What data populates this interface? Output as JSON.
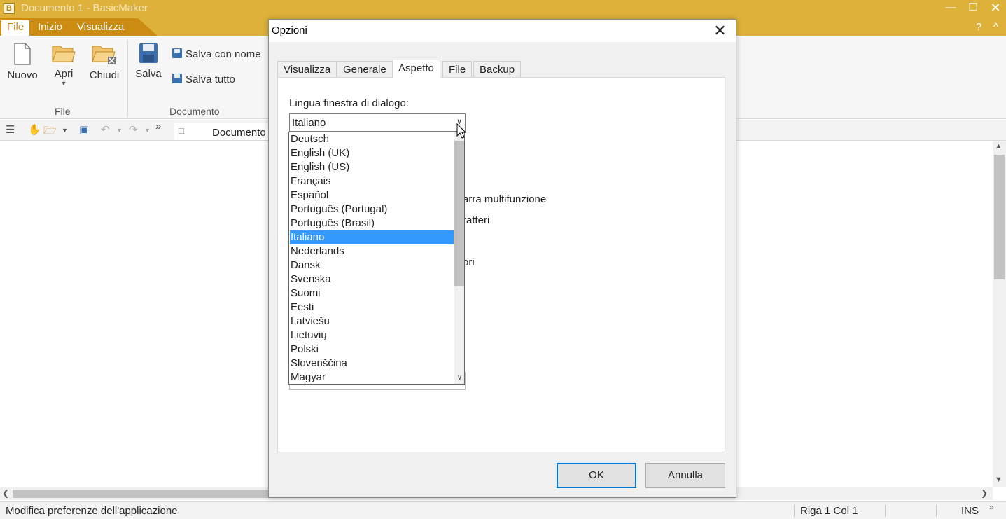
{
  "app": {
    "title": "Documento 1 - BasicMaker",
    "icon_letter": "B",
    "window_controls": [
      "minimize-icon",
      "maximize-icon",
      "close-icon"
    ]
  },
  "ribbon": {
    "tabs": [
      "File",
      "Inizio",
      "Visualizza"
    ],
    "help": "?",
    "collapse": "^",
    "new_label": "Nuovo",
    "open_label": "Apri",
    "close_label": "Chiudi",
    "save_label": "Salva",
    "save_as_label": "Salva con nome",
    "save_all_label": "Salva tutto",
    "group_file": "File",
    "group_document": "Documento"
  },
  "toolbar": {
    "doc_tab": "Documento"
  },
  "dialog": {
    "title": "Opzioni",
    "tabs": [
      "Visualizza",
      "Generale",
      "Aspetto",
      "File",
      "Backup"
    ],
    "active_tab": "Aspetto",
    "lang_label": "Lingua finestra di dialogo:",
    "lang_value": "Italiano",
    "hidden_text_1": "arra multifunzione",
    "hidden_text_2": "ratteri",
    "hidden_text_3": "ori",
    "ok": "OK",
    "cancel": "Annulla"
  },
  "dropdown": {
    "items": [
      "Deutsch",
      "English (UK)",
      "English (US)",
      "Français",
      "Español",
      "Português (Portugal)",
      "Português (Brasil)",
      "Italiano",
      "Nederlands",
      "Dansk",
      "Svenska",
      "Suomi",
      "Eesti",
      "Latviešu",
      "Lietuvių",
      "Polski",
      "Slovenščina",
      "Magyar"
    ],
    "selected": "Italiano"
  },
  "status": {
    "message": "Modifica preferenze dell'applicazione",
    "position": "Riga 1 Col 1",
    "mode": "INS"
  },
  "colors": {
    "accent": "#deb23a",
    "accent_dark": "#cc8c12",
    "selection": "#3399ff"
  }
}
